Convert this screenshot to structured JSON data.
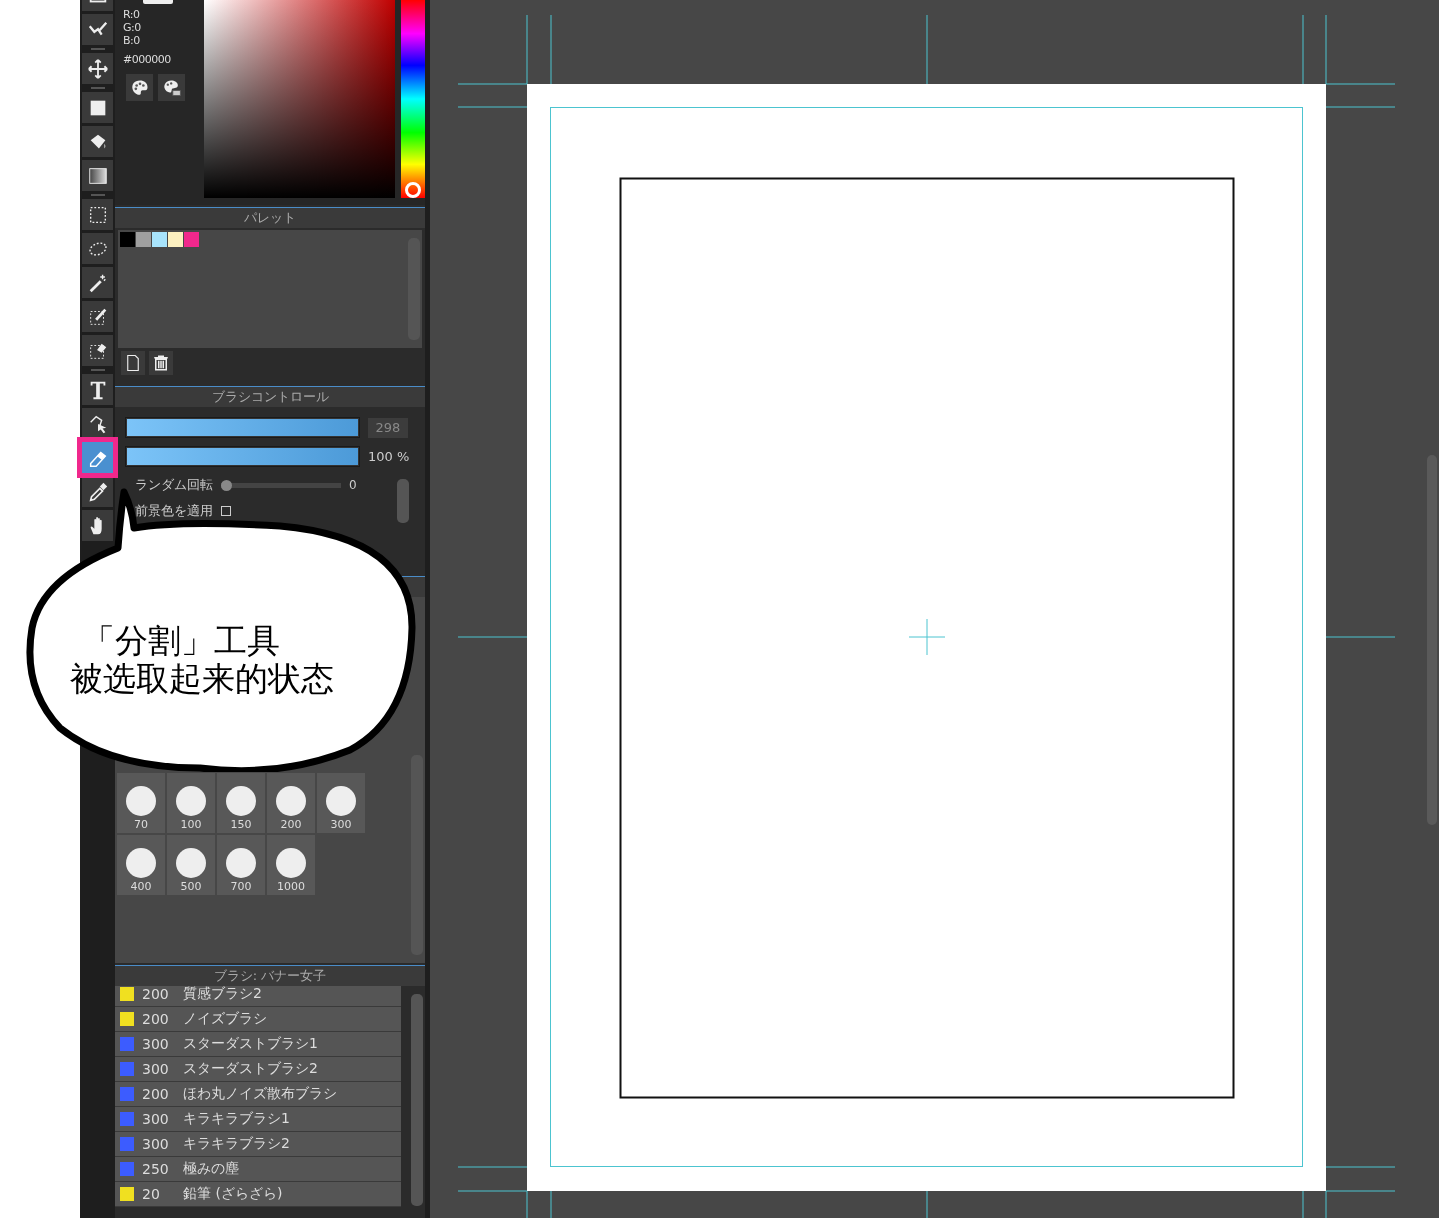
{
  "toolbar": {
    "groups": [
      [
        {
          "kind": "frame",
          "selected": false
        },
        {
          "kind": "polyline",
          "selected": false
        }
      ],
      [
        {
          "kind": "move",
          "selected": false
        }
      ],
      [
        {
          "kind": "fill-rect",
          "selected": false
        },
        {
          "kind": "bucket",
          "selected": false
        },
        {
          "kind": "gradient",
          "selected": false
        }
      ],
      [
        {
          "kind": "rect-select",
          "selected": false
        },
        {
          "kind": "lasso",
          "selected": false
        },
        {
          "kind": "wand",
          "selected": false
        },
        {
          "kind": "select-pen",
          "selected": false
        },
        {
          "kind": "select-eraser",
          "selected": false
        }
      ],
      [
        {
          "kind": "text",
          "selected": false
        },
        {
          "kind": "object",
          "selected": false
        },
        {
          "kind": "divide",
          "selected": true
        },
        {
          "kind": "dropper",
          "selected": false
        },
        {
          "kind": "hand",
          "selected": false
        }
      ]
    ]
  },
  "color_panel": {
    "channels": [
      "R:0",
      "G:0",
      "B:0"
    ],
    "hex": "#000000",
    "hue": {
      "level": 0
    }
  },
  "palette_panel": {
    "title": "パレット",
    "swatches": [
      {
        "color": "#000000"
      },
      {
        "color": "#a0a0a0"
      },
      {
        "color": "#a8e4fc"
      },
      {
        "color": "#fcf0c0"
      },
      {
        "color": "#f0288c"
      }
    ]
  },
  "brush_control": {
    "title": "ブラシコントロール",
    "size": {
      "level": 1,
      "value": "298"
    },
    "opacity": {
      "level": 1,
      "value": "100 %"
    },
    "options": [
      {
        "kind": "slider",
        "label": "ランダム回転",
        "level": 0,
        "value": "0"
      },
      {
        "kind": "checkbox",
        "label": "前景色を適用",
        "checked": false
      }
    ]
  },
  "brush_size_panel": {
    "sizes": [
      "70",
      "100",
      "150",
      "200",
      "300",
      "400",
      "500",
      "700",
      "1000"
    ]
  },
  "brush_list": {
    "title": "ブラシ: バナー女子",
    "brushes": [
      {
        "color": "#f0e020",
        "size": "200",
        "name": "質感ブラシ2"
      },
      {
        "color": "#f0e020",
        "size": "200",
        "name": "ノイズブラシ"
      },
      {
        "color": "#3c5cff",
        "size": "300",
        "name": "スターダストブラシ1"
      },
      {
        "color": "#3c5cff",
        "size": "300",
        "name": "スターダストブラシ2"
      },
      {
        "color": "#3c5cff",
        "size": "200",
        "name": "ほわ丸ノイズ散布ブラシ"
      },
      {
        "color": "#3c5cff",
        "size": "300",
        "name": "キラキラブラシ1"
      },
      {
        "color": "#3c5cff",
        "size": "300",
        "name": "キラキラブラシ2"
      },
      {
        "color": "#3c5cff",
        "size": "250",
        "name": "極みの塵"
      },
      {
        "color": "#f0e020",
        "size": "20",
        "name": "鉛筆 (ざらざら)"
      }
    ]
  },
  "callout": {
    "lines": [
      "「分割」工具",
      "被选取起来的状态"
    ]
  }
}
